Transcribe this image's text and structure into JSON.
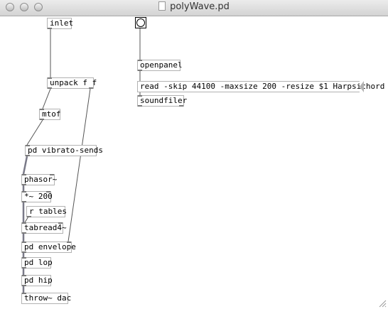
{
  "window": {
    "title": "polyWave.pd"
  },
  "objects": {
    "inlet": "inlet",
    "unpack": "unpack f f",
    "mtof": "mtof",
    "vibrato": "pd vibrato-sends",
    "phasor": "phasor~",
    "mult": "*~ 200",
    "rtables": "r tables",
    "tabread": "tabread4~",
    "envelope": "pd envelope",
    "lop": "pd lop",
    "hip": "pd hip",
    "throw": "throw~ dac",
    "openpanel": "openpanel",
    "soundfiler": "soundfiler"
  },
  "messages": {
    "read": "read -skip 44100 -maxsize 200 -resize $1 Harpsichord"
  }
}
